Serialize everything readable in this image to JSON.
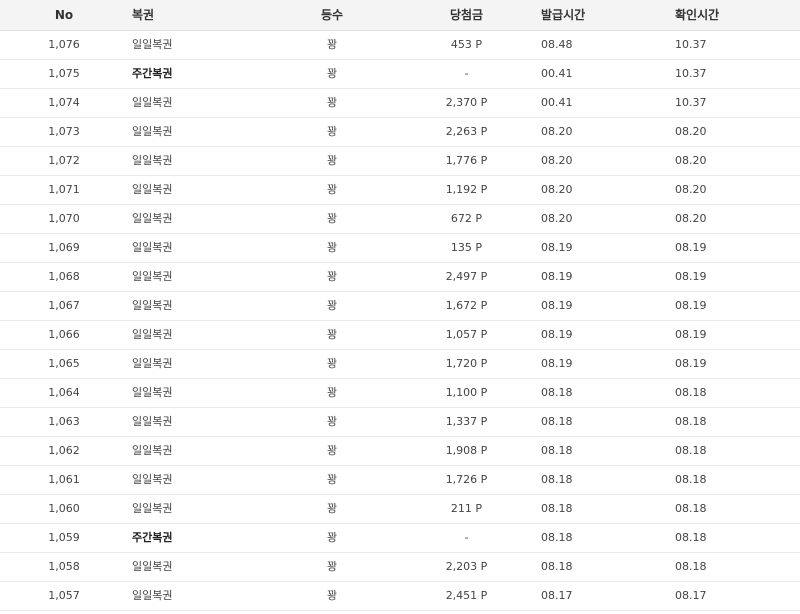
{
  "headers": {
    "no": "No",
    "type": "복권",
    "rank": "등수",
    "prize": "당첨금",
    "issued": "발급시간",
    "checked": "확인시간"
  },
  "rows": [
    {
      "no": "1,076",
      "type": "일일복권",
      "rank": "꽝",
      "prize": "453 P",
      "issued": "08.48",
      "checked": "10.37"
    },
    {
      "no": "1,075",
      "type": "주간복권",
      "rank": "꽝",
      "prize": "-",
      "issued": "00.41",
      "checked": "10.37"
    },
    {
      "no": "1,074",
      "type": "일일복권",
      "rank": "꽝",
      "prize": "2,370 P",
      "issued": "00.41",
      "checked": "10.37"
    },
    {
      "no": "1,073",
      "type": "일일복권",
      "rank": "꽝",
      "prize": "2,263 P",
      "issued": "08.20",
      "checked": "08.20"
    },
    {
      "no": "1,072",
      "type": "일일복권",
      "rank": "꽝",
      "prize": "1,776 P",
      "issued": "08.20",
      "checked": "08.20"
    },
    {
      "no": "1,071",
      "type": "일일복권",
      "rank": "꽝",
      "prize": "1,192 P",
      "issued": "08.20",
      "checked": "08.20"
    },
    {
      "no": "1,070",
      "type": "일일복권",
      "rank": "꽝",
      "prize": "672 P",
      "issued": "08.20",
      "checked": "08.20"
    },
    {
      "no": "1,069",
      "type": "일일복권",
      "rank": "꽝",
      "prize": "135 P",
      "issued": "08.19",
      "checked": "08.19"
    },
    {
      "no": "1,068",
      "type": "일일복권",
      "rank": "꽝",
      "prize": "2,497 P",
      "issued": "08.19",
      "checked": "08.19"
    },
    {
      "no": "1,067",
      "type": "일일복권",
      "rank": "꽝",
      "prize": "1,672 P",
      "issued": "08.19",
      "checked": "08.19"
    },
    {
      "no": "1,066",
      "type": "일일복권",
      "rank": "꽝",
      "prize": "1,057 P",
      "issued": "08.19",
      "checked": "08.19"
    },
    {
      "no": "1,065",
      "type": "일일복권",
      "rank": "꽝",
      "prize": "1,720 P",
      "issued": "08.19",
      "checked": "08.19"
    },
    {
      "no": "1,064",
      "type": "일일복권",
      "rank": "꽝",
      "prize": "1,100 P",
      "issued": "08.18",
      "checked": "08.18"
    },
    {
      "no": "1,063",
      "type": "일일복권",
      "rank": "꽝",
      "prize": "1,337 P",
      "issued": "08.18",
      "checked": "08.18"
    },
    {
      "no": "1,062",
      "type": "일일복권",
      "rank": "꽝",
      "prize": "1,908 P",
      "issued": "08.18",
      "checked": "08.18"
    },
    {
      "no": "1,061",
      "type": "일일복권",
      "rank": "꽝",
      "prize": "1,726 P",
      "issued": "08.18",
      "checked": "08.18"
    },
    {
      "no": "1,060",
      "type": "일일복권",
      "rank": "꽝",
      "prize": "211 P",
      "issued": "08.18",
      "checked": "08.18"
    },
    {
      "no": "1,059",
      "type": "주간복권",
      "rank": "꽝",
      "prize": "-",
      "issued": "08.18",
      "checked": "08.18"
    },
    {
      "no": "1,058",
      "type": "일일복권",
      "rank": "꽝",
      "prize": "2,203 P",
      "issued": "08.18",
      "checked": "08.18"
    },
    {
      "no": "1,057",
      "type": "일일복권",
      "rank": "꽝",
      "prize": "2,451 P",
      "issued": "08.17",
      "checked": "08.17"
    }
  ]
}
